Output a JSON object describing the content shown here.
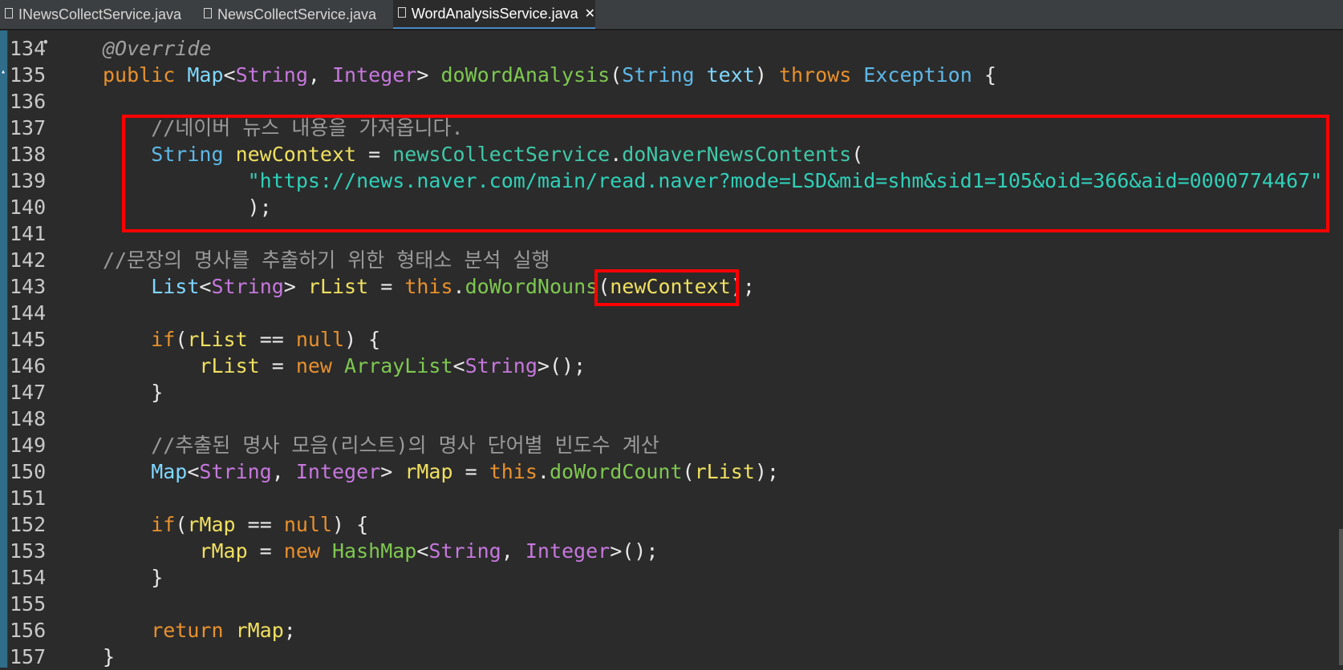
{
  "tabs": [
    {
      "label": "INewsCollectService.java",
      "active": false
    },
    {
      "label": "NewsCollectService.java",
      "active": false
    },
    {
      "label": "WordAnalysisService.java",
      "active": true
    }
  ],
  "close_glyph": "✕",
  "lines": [
    {
      "n": "134",
      "segs": [
        [
          "ann",
          "@Override"
        ]
      ]
    },
    {
      "n": "135",
      "segs": [
        [
          "kw",
          "public "
        ],
        [
          "cls",
          "Map"
        ],
        [
          "pl",
          "<"
        ],
        [
          "gen",
          "String"
        ],
        [
          "pl",
          ", "
        ],
        [
          "gen",
          "Integer"
        ],
        [
          "pl",
          "> "
        ],
        [
          "fn",
          "doWordAnalysis"
        ],
        [
          "pl",
          "("
        ],
        [
          "ty",
          "String "
        ],
        [
          "cls",
          "text"
        ],
        [
          "pl",
          ") "
        ],
        [
          "kw",
          "throws "
        ],
        [
          "ty",
          "Exception"
        ],
        [
          "pl",
          " {"
        ]
      ]
    },
    {
      "n": "136",
      "segs": []
    },
    {
      "n": "137",
      "segs": [
        [
          "cm",
          "    //네이버 뉴스 내용을 가져옵니다."
        ]
      ]
    },
    {
      "n": "138",
      "segs": [
        [
          "ty",
          "    String "
        ],
        [
          "var",
          "newContext"
        ],
        [
          "pl",
          " = "
        ],
        [
          "mth",
          "newsCollectService"
        ],
        [
          "pl",
          "."
        ],
        [
          "mth",
          "doNaverNewsContents"
        ],
        [
          "pl",
          "("
        ]
      ]
    },
    {
      "n": "139",
      "segs": [
        [
          "str",
          "            \"https://news.naver.com/main/read.naver?mode=LSD&mid=shm&sid1=105&oid=366&aid=0000774467\""
        ]
      ]
    },
    {
      "n": "140",
      "segs": [
        [
          "pl",
          "            );"
        ]
      ]
    },
    {
      "n": "141",
      "segs": []
    },
    {
      "n": "142",
      "segs": [
        [
          "cm",
          "//문장의 명사를 추출하기 위한 형태소 분석 실행"
        ]
      ]
    },
    {
      "n": "143",
      "segs": [
        [
          "cls",
          "    List"
        ],
        [
          "pl",
          "<"
        ],
        [
          "gen",
          "String"
        ],
        [
          "pl",
          "> "
        ],
        [
          "var",
          "rList"
        ],
        [
          "pl",
          " = "
        ],
        [
          "kw",
          "this"
        ],
        [
          "pl",
          "."
        ],
        [
          "fn",
          "doWordNouns"
        ],
        [
          "pl",
          "("
        ],
        [
          "var",
          "newContext"
        ],
        [
          "pl",
          ");"
        ]
      ]
    },
    {
      "n": "144",
      "segs": []
    },
    {
      "n": "145",
      "segs": [
        [
          "kw",
          "    if"
        ],
        [
          "pl",
          "("
        ],
        [
          "var",
          "rList"
        ],
        [
          "pl",
          " == "
        ],
        [
          "kw",
          "null"
        ],
        [
          "pl",
          ") {"
        ]
      ]
    },
    {
      "n": "146",
      "segs": [
        [
          "var",
          "        rList"
        ],
        [
          "pl",
          " = "
        ],
        [
          "kw",
          "new "
        ],
        [
          "fn",
          "ArrayList"
        ],
        [
          "pl",
          "<"
        ],
        [
          "gen",
          "String"
        ],
        [
          "pl",
          ">();"
        ]
      ]
    },
    {
      "n": "147",
      "segs": [
        [
          "pl",
          "    }"
        ]
      ]
    },
    {
      "n": "148",
      "segs": []
    },
    {
      "n": "149",
      "segs": [
        [
          "cm",
          "    //추출된 명사 모음(리스트)의 명사 단어별 빈도수 계산"
        ]
      ]
    },
    {
      "n": "150",
      "segs": [
        [
          "cls",
          "    Map"
        ],
        [
          "pl",
          "<"
        ],
        [
          "gen",
          "String"
        ],
        [
          "pl",
          ", "
        ],
        [
          "gen",
          "Integer"
        ],
        [
          "pl",
          "> "
        ],
        [
          "var",
          "rMap"
        ],
        [
          "pl",
          " = "
        ],
        [
          "kw",
          "this"
        ],
        [
          "pl",
          "."
        ],
        [
          "fn",
          "doWordCount"
        ],
        [
          "pl",
          "("
        ],
        [
          "var",
          "rList"
        ],
        [
          "pl",
          ");"
        ]
      ]
    },
    {
      "n": "151",
      "segs": []
    },
    {
      "n": "152",
      "segs": [
        [
          "kw",
          "    if"
        ],
        [
          "pl",
          "("
        ],
        [
          "var",
          "rMap"
        ],
        [
          "pl",
          " == "
        ],
        [
          "kw",
          "null"
        ],
        [
          "pl",
          ") {"
        ]
      ]
    },
    {
      "n": "153",
      "segs": [
        [
          "var",
          "        rMap"
        ],
        [
          "pl",
          " = "
        ],
        [
          "kw",
          "new "
        ],
        [
          "fn",
          "HashMap"
        ],
        [
          "pl",
          "<"
        ],
        [
          "gen",
          "String"
        ],
        [
          "pl",
          ", "
        ],
        [
          "gen",
          "Integer"
        ],
        [
          "pl",
          ">();"
        ]
      ]
    },
    {
      "n": "154",
      "segs": [
        [
          "pl",
          "    }"
        ]
      ]
    },
    {
      "n": "155",
      "segs": []
    },
    {
      "n": "156",
      "segs": [
        [
          "kw",
          "    return "
        ],
        [
          "var",
          "rMap"
        ],
        [
          "pl",
          ";"
        ]
      ]
    },
    {
      "n": "157",
      "segs": [
        [
          "pl",
          "}"
        ]
      ]
    }
  ],
  "colors": {
    "highlight": "#ff0000",
    "background": "#2b2b2b"
  }
}
